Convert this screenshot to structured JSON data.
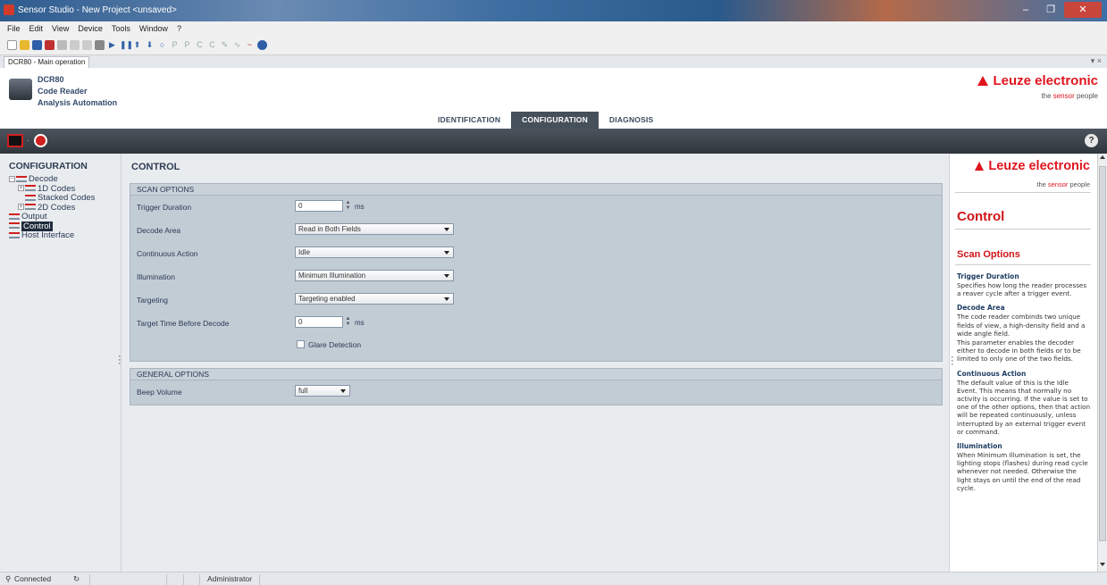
{
  "window": {
    "title": "Sensor Studio - New Project <unsaved>",
    "minimize": "–",
    "maximize": "❐",
    "close": "✕"
  },
  "menu": [
    "File",
    "Edit",
    "View",
    "Device",
    "Tools",
    "Window",
    "?"
  ],
  "doc_tab": {
    "label": "DCR80 - Main operation",
    "pin": "▾ ×"
  },
  "device": {
    "model": "DCR80",
    "type": "Code Reader",
    "subtitle": "Analysis Automation"
  },
  "brand": {
    "name": "Leuze electronic",
    "tag_prefix": "the ",
    "tag_accent": "sensor",
    "tag_suffix": " people"
  },
  "mode_tabs": [
    {
      "label": "IDENTIFICATION",
      "active": false
    },
    {
      "label": "CONFIGURATION",
      "active": true
    },
    {
      "label": "DIAGNOSIS",
      "active": false
    }
  ],
  "help_button": "?",
  "tree": {
    "title": "CONFIGURATION",
    "nodes": [
      {
        "label": "Decode",
        "expander": "⊟"
      },
      {
        "label": "1D Codes",
        "expander": "⊞"
      },
      {
        "label": "Stacked Codes"
      },
      {
        "label": "2D Codes",
        "expander": "⊞"
      },
      {
        "label": "Output"
      },
      {
        "label": "Control",
        "selected": true
      },
      {
        "label": "Host Interface"
      }
    ]
  },
  "control": {
    "title": "CONTROL",
    "scan_options": {
      "header": "SCAN OPTIONS",
      "trigger_duration": {
        "label": "Trigger Duration",
        "value": "0",
        "unit": "ms"
      },
      "decode_area": {
        "label": "Decode Area",
        "value": "Read in Both Fields"
      },
      "continuous_action": {
        "label": "Continuous Action",
        "value": "Idle"
      },
      "illumination": {
        "label": "Illumination",
        "value": "Minimum Illumination"
      },
      "targeting": {
        "label": "Targeting",
        "value": "Targeting enabled"
      },
      "target_time": {
        "label": "Target Time Before Decode",
        "value": "0",
        "unit": "ms"
      },
      "glare_detection": {
        "label": "Glare Detection",
        "checked": false
      }
    },
    "general_options": {
      "header": "GENERAL OPTIONS",
      "beep_volume": {
        "label": "Beep Volume",
        "value": "full"
      }
    }
  },
  "help_panel": {
    "title": "Control",
    "section": "Scan Options",
    "entries": [
      {
        "heading": "Trigger Duration",
        "text": "Specifies how long the reader processes a reaver cycle after a trigger event."
      },
      {
        "heading": "Decode Area",
        "text": "The code reader combinds two unique fields of view, a high-density field and a wide angle field."
      },
      {
        "heading": "",
        "text": "This parameter enables the decoder either to decode in both fields or to be limited to only one of the two fields."
      },
      {
        "heading": "Continuous Action",
        "text": "The default value of this is the Idle Event. This means that normally no activity is occurring. If the value is set to one of the other options, then that action will be repeated continuously, unless interrupted by an external trigger event or command."
      },
      {
        "heading": "Illumination",
        "text": "When Minimum Illumination is set, the lighting stops (flashes) during read cycle whenever not needed. Otherwise the light stays on until the end of the read cycle."
      }
    ]
  },
  "status": {
    "connection": "Connected",
    "refresh_icon": "↻",
    "user": "Administrator"
  },
  "colors": {
    "brand_red": "#e0141e",
    "header_dark": "#3b434b",
    "group_bg": "#c2ccd5"
  }
}
